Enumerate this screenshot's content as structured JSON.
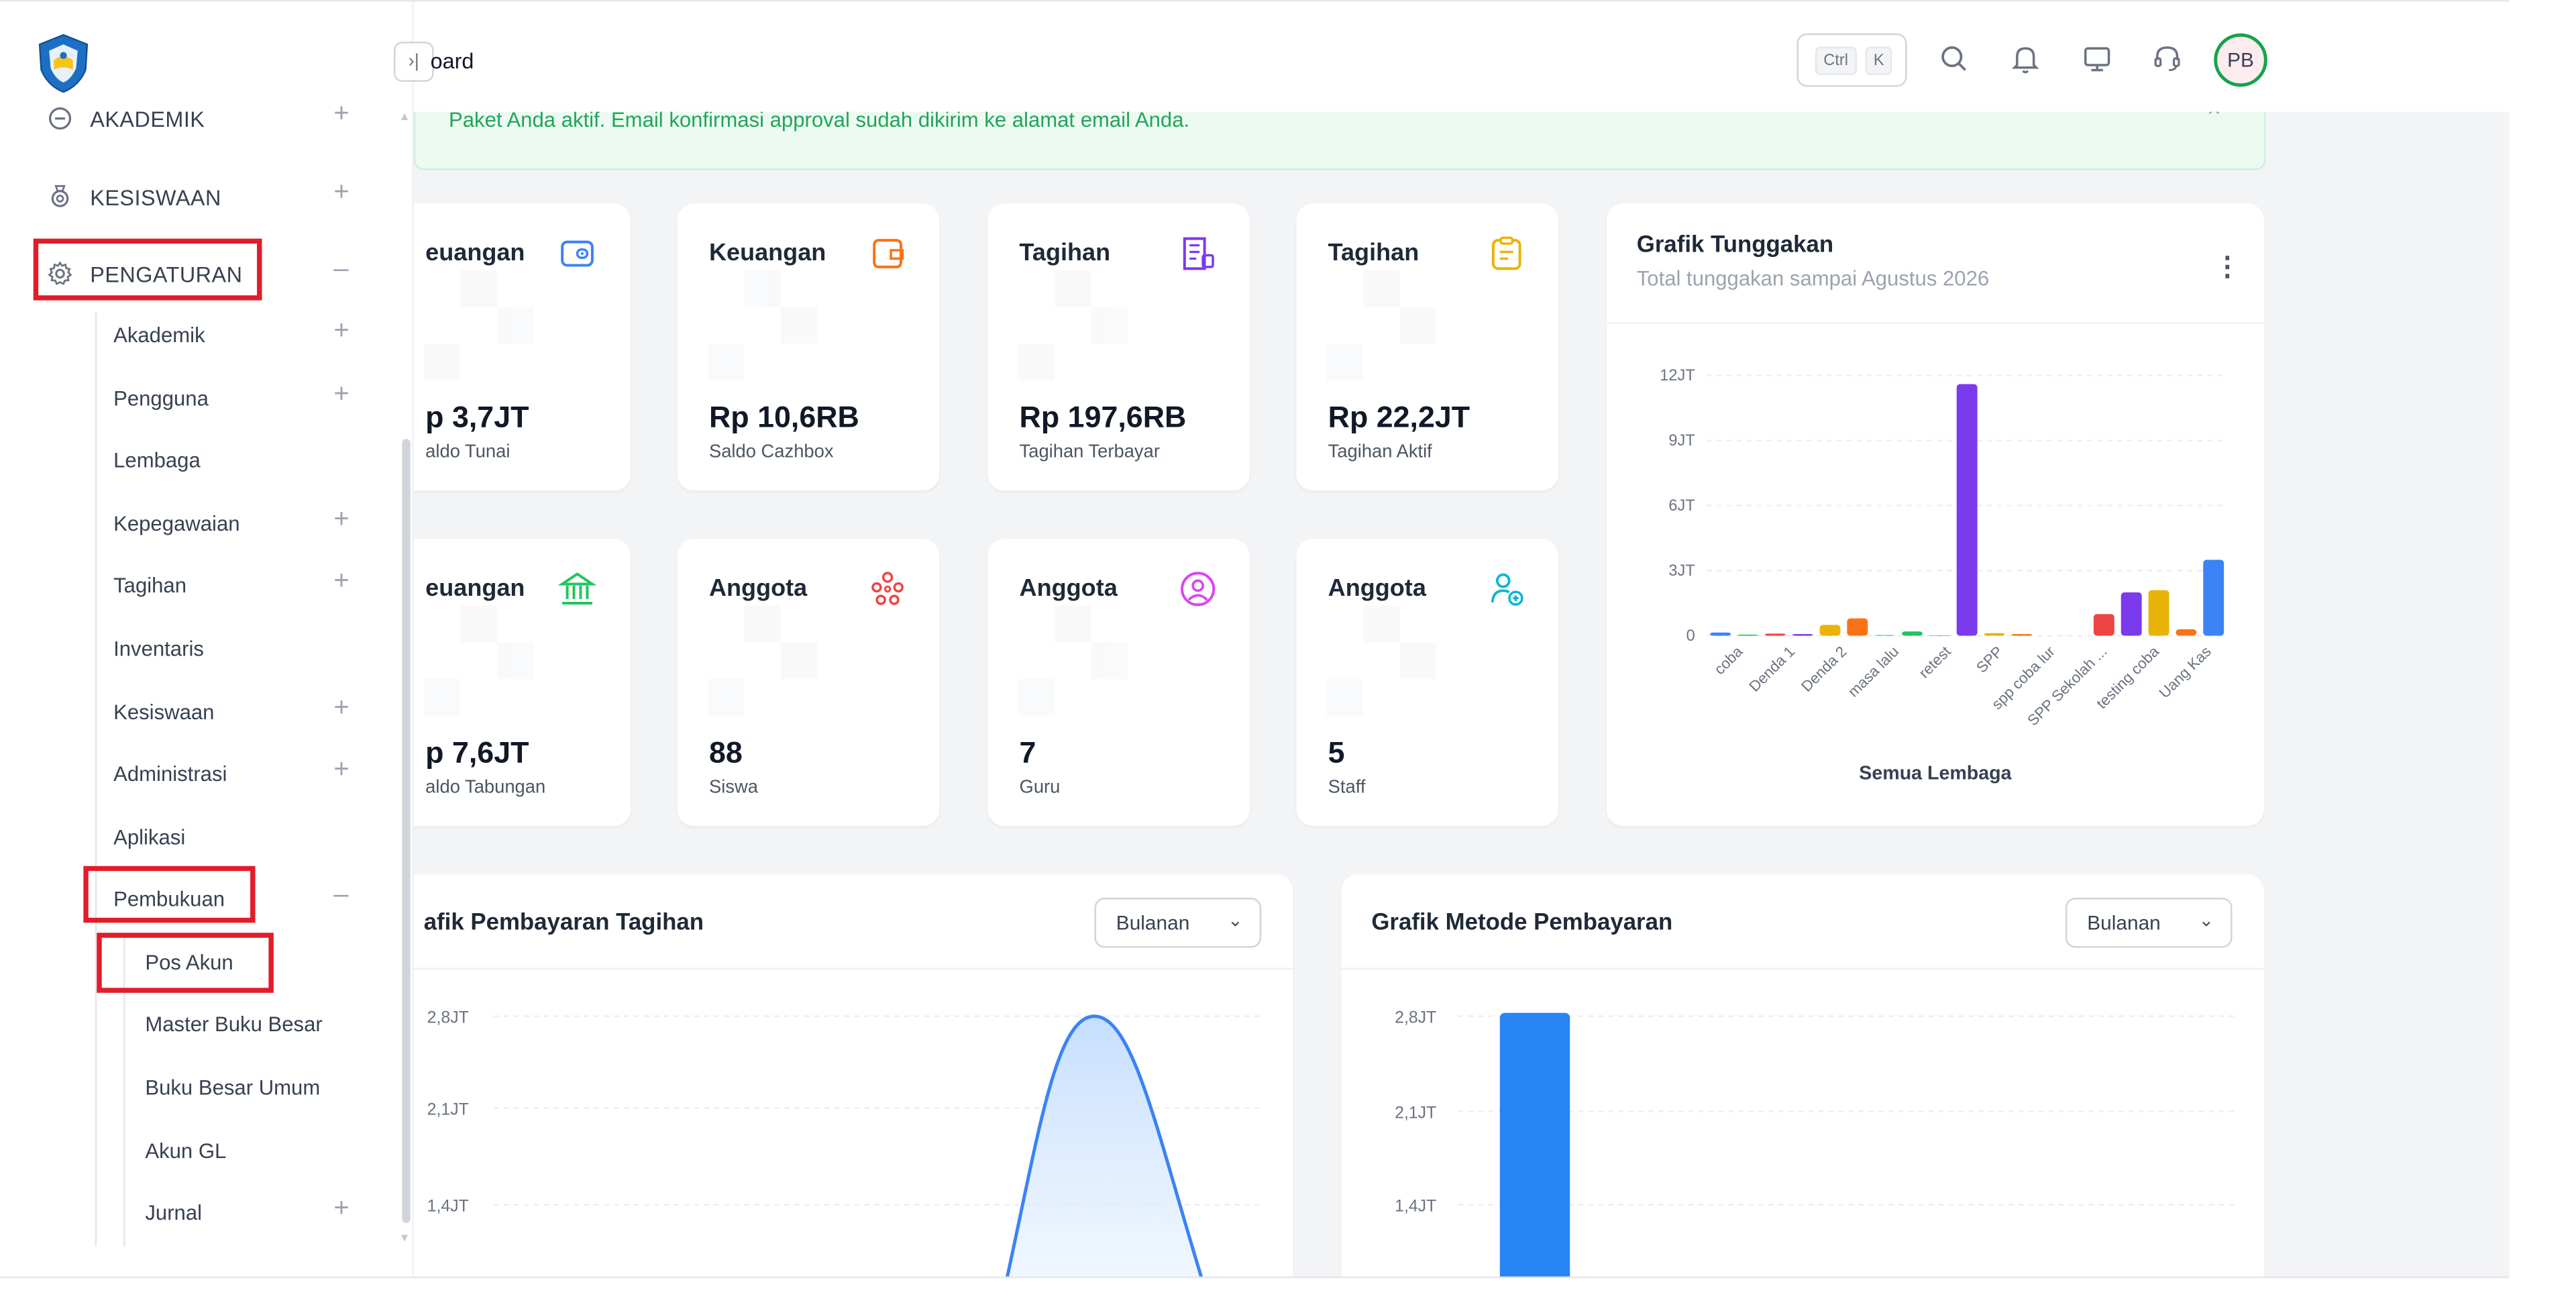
{
  "sidebar": {
    "menu": [
      {
        "label": "AKADEMIK",
        "expand": "+"
      },
      {
        "label": "KESISWAAN",
        "expand": "+"
      },
      {
        "label": "PENGATURAN",
        "expand": "–"
      }
    ],
    "submenu": [
      {
        "label": "Akademik",
        "expand": "+"
      },
      {
        "label": "Pengguna",
        "expand": "+"
      },
      {
        "label": "Lembaga",
        "expand": ""
      },
      {
        "label": "Kepegawaian",
        "expand": "+"
      },
      {
        "label": "Tagihan",
        "expand": "+"
      },
      {
        "label": "Inventaris",
        "expand": ""
      },
      {
        "label": "Kesiswaan",
        "expand": "+"
      },
      {
        "label": "Administrasi",
        "expand": "+"
      },
      {
        "label": "Aplikasi",
        "expand": ""
      },
      {
        "label": "Pembukuan",
        "expand": "–"
      }
    ],
    "pembukuan_items": [
      {
        "label": "Pos Akun",
        "expand": ""
      },
      {
        "label": "Master Buku Besar",
        "expand": ""
      },
      {
        "label": "Buku Besar Umum",
        "expand": ""
      },
      {
        "label": "Akun GL",
        "expand": ""
      },
      {
        "label": "Jurnal",
        "expand": "+"
      }
    ]
  },
  "header": {
    "breadcrumb": "oard",
    "collapse_glyph": "›|",
    "shortcut_keys": [
      "Ctrl",
      "K"
    ],
    "avatar_initials": "PB"
  },
  "alert": {
    "message": "Paket Anda aktif. Email konfirmasi approval sudah dikirim ke alamat email Anda.",
    "close": "×"
  },
  "stat_cards": [
    {
      "title": "euangan",
      "value": "p 3,7JT",
      "subtitle": "aldo Tunai",
      "icon": "wallet-icon",
      "color": "#3b82f6"
    },
    {
      "title": "Keuangan",
      "value": "Rp 10,6RB",
      "subtitle": "Saldo Cazhbox",
      "icon": "wallet-card-icon",
      "color": "#f97316"
    },
    {
      "title": "Tagihan",
      "value": "Rp 197,6RB",
      "subtitle": "Tagihan Terbayar",
      "icon": "receipt-icon",
      "color": "#7c3aed"
    },
    {
      "title": "Tagihan",
      "value": "Rp 22,2JT",
      "subtitle": "Tagihan Aktif",
      "icon": "clipboard-icon",
      "color": "#eab308"
    },
    {
      "title": "euangan",
      "value": "p 7,6JT",
      "subtitle": "aldo Tabungan",
      "icon": "bank-icon",
      "color": "#22c55e"
    },
    {
      "title": "Anggota",
      "value": "88",
      "subtitle": "Siswa",
      "icon": "users-group-icon",
      "color": "#ef4444"
    },
    {
      "title": "Anggota",
      "value": "7",
      "subtitle": "Guru",
      "icon": "user-circle-icon",
      "color": "#d946ef"
    },
    {
      "title": "Anggota",
      "value": "5",
      "subtitle": "Staff",
      "icon": "user-add-icon",
      "color": "#06b6d4"
    }
  ],
  "tunggakan": {
    "title": "Grafik Tunggakan",
    "subtitle": "Total tunggakan sampai Agustus 2026",
    "kebab": "⋮",
    "yticks": [
      "12JT",
      "9JT",
      "6JT",
      "3JT",
      "0"
    ],
    "xlabels": [
      "coba",
      "Denda 1",
      "Denda 2",
      "masa lalu",
      "retest",
      "SPP",
      "spp coba lur",
      "SPP Sekolah ...",
      "testing coba",
      "Uang Kas"
    ],
    "legend": "Semua Lembaga"
  },
  "pembayaran_tagihan": {
    "title": "afik Pembayaran Tagihan",
    "select": "Bulanan",
    "yticks": [
      "2,8JT",
      "2,1JT",
      "1,4JT"
    ]
  },
  "metode_pembayaran": {
    "title": "Grafik Metode Pembayaran",
    "select": "Bulanan",
    "yticks": [
      "2,8JT",
      "2,1JT",
      "1,4JT"
    ]
  },
  "chart_data": [
    {
      "type": "bar",
      "title": "Grafik Tunggakan",
      "subtitle": "Total tunggakan sampai Agustus 2026",
      "ylim": [
        0,
        12000000
      ],
      "yticks": [
        "0",
        "3JT",
        "6JT",
        "9JT",
        "12JT"
      ],
      "legend": "Semua Lembaga",
      "bars": [
        {
          "value": 150000,
          "color": "#3b82f6"
        },
        {
          "value": 50000,
          "color": "#22c55e"
        },
        {
          "value": 100000,
          "color": "#ef4444"
        },
        {
          "value": 80000,
          "color": "#7c3aed"
        },
        {
          "value": 500000,
          "color": "#eab308"
        },
        {
          "value": 800000,
          "color": "#f97316"
        },
        {
          "value": 30000,
          "color": "#06b6d4"
        },
        {
          "value": 200000,
          "color": "#22c55e"
        },
        {
          "value": 20000,
          "color": "#3b82f6"
        },
        {
          "value": 11600000,
          "color": "#7c3aed"
        },
        {
          "value": 120000,
          "color": "#eab308"
        },
        {
          "value": 80000,
          "color": "#f97316"
        },
        {
          "value": 0,
          "color": "#06b6d4"
        },
        {
          "value": 0,
          "color": "#3b82f6"
        },
        {
          "value": 1000000,
          "color": "#ef4444"
        },
        {
          "value": 2000000,
          "color": "#7c3aed"
        },
        {
          "value": 2100000,
          "color": "#eab308"
        },
        {
          "value": 300000,
          "color": "#f97316"
        },
        {
          "value": 3500000,
          "color": "#3b82f6"
        }
      ]
    },
    {
      "type": "area",
      "title": "afik Pembayaran Tagihan",
      "ylim": [
        0,
        3000000
      ],
      "yticks": [
        "1,4JT",
        "2,1JT",
        "2,8JT"
      ],
      "peak_value": 2800000,
      "color": "#3b82f6"
    },
    {
      "type": "bar",
      "title": "Grafik Metode Pembayaran",
      "ylim": [
        0,
        3000000
      ],
      "yticks": [
        "1,4JT",
        "2,1JT",
        "2,8JT"
      ],
      "values": [
        2800000
      ],
      "color": "#2684f5"
    }
  ]
}
